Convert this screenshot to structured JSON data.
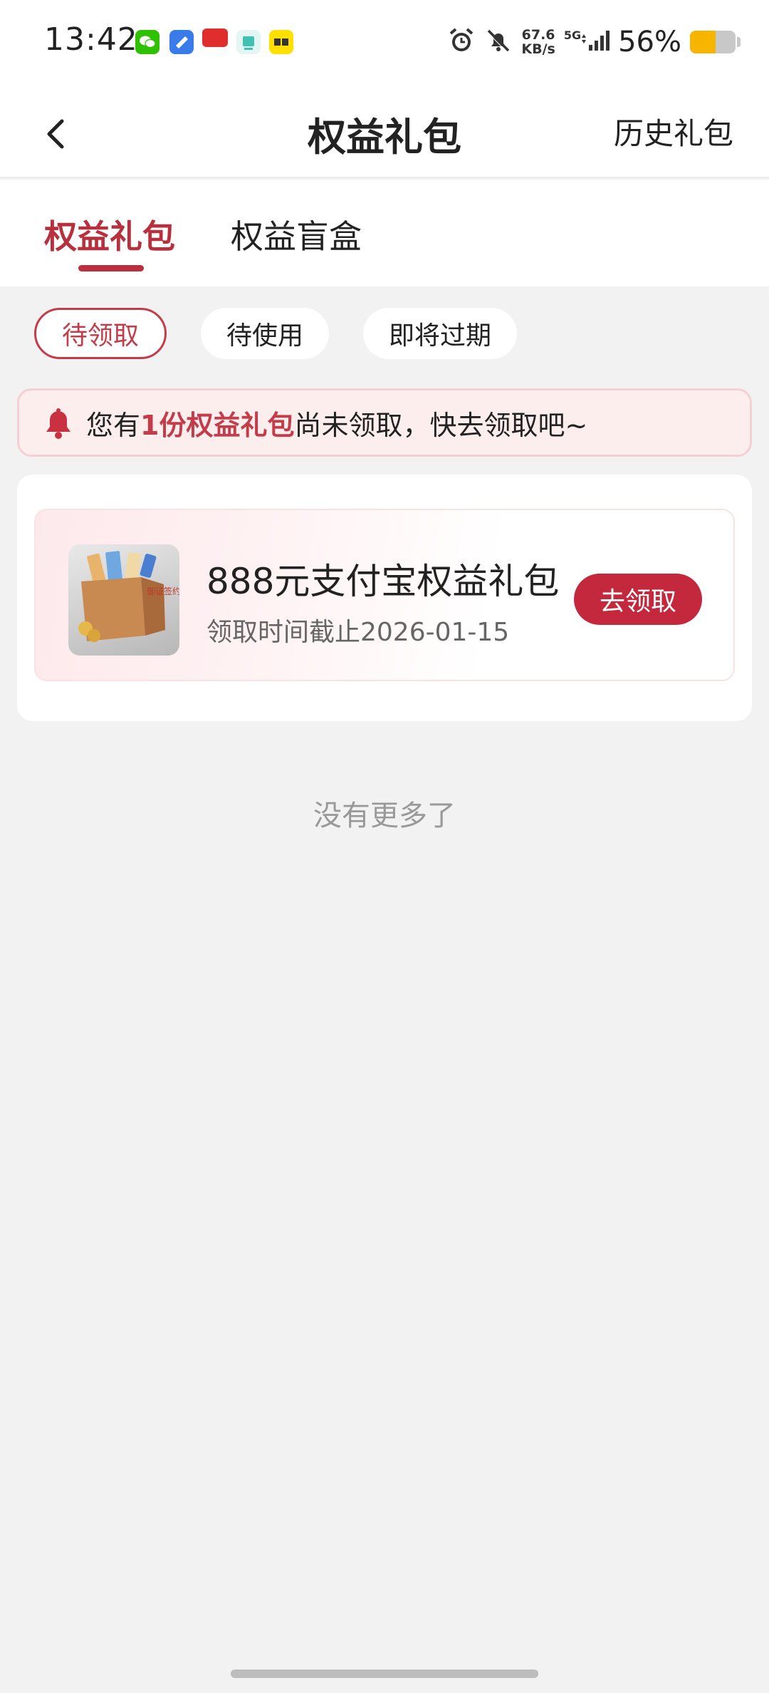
{
  "status_bar": {
    "time": "13:42",
    "network_speed_value": "67.6",
    "network_speed_unit": "KB/s",
    "network_type": "5G",
    "battery_percent": "56%",
    "battery_level": 0.56,
    "app_icons": [
      "wechat-icon",
      "blue-app-icon",
      "red-app-icon",
      "teal-app-icon",
      "yellow-app-icon"
    ]
  },
  "header": {
    "title": "权益礼包",
    "history_label": "历史礼包"
  },
  "tabs": [
    {
      "label": "权益礼包",
      "active": true
    },
    {
      "label": "权益盲盒",
      "active": false
    }
  ],
  "filters": [
    {
      "label": "待领取",
      "active": true
    },
    {
      "label": "待使用",
      "active": false
    },
    {
      "label": "即将过期",
      "active": false
    }
  ],
  "notice": {
    "prefix": "您有",
    "highlight": "1份权益礼包",
    "suffix": "尚未领取，快去领取吧~"
  },
  "gift": {
    "name": "888元支付宝权益礼包",
    "deadline": "领取时间截止2026-01-15",
    "claim_label": "去领取",
    "image_text": "御证签约"
  },
  "footer": {
    "no_more": "没有更多了"
  },
  "colors": {
    "accent": "#b8303e",
    "button": "#c4283c",
    "notice_bg": "#fdeeee",
    "page_bg": "#f2f2f2"
  }
}
